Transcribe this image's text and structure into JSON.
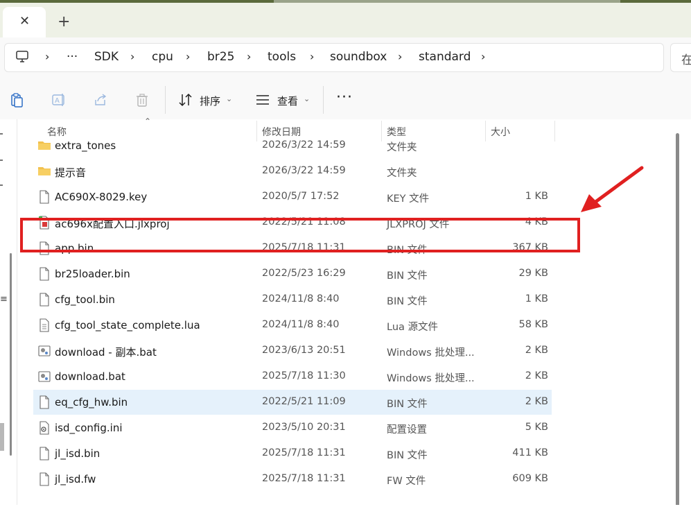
{
  "tabs": {
    "close_glyph": "✕",
    "new_glyph": "+"
  },
  "address": {
    "ellipsis": "···",
    "crumbs": [
      "SDK",
      "cpu",
      "br25",
      "tools",
      "soundbox",
      "standard"
    ],
    "search_text": "在"
  },
  "toolbar": {
    "sort_label": "排序",
    "view_label": "查看",
    "more_glyph": "···"
  },
  "columns": {
    "name": "名称",
    "date": "修改日期",
    "type": "类型",
    "size": "大小"
  },
  "files": [
    {
      "name": "extra_tones",
      "date": "2026/3/22 14:59",
      "type": "文件夹",
      "size": "",
      "icon": "folder-icon"
    },
    {
      "name": "提示音",
      "date": "2026/3/22 14:59",
      "type": "文件夹",
      "size": "",
      "icon": "folder-icon"
    },
    {
      "name": "AC690X-8029.key",
      "date": "2020/5/7 17:52",
      "type": "KEY 文件",
      "size": "1 KB",
      "icon": "file-icon"
    },
    {
      "name": "ac696x配置入口.jlxproj",
      "date": "2022/5/21 11:08",
      "type": "JLXPROJ 文件",
      "size": "4 KB",
      "icon": "jlxproj-file-icon"
    },
    {
      "name": "app.bin",
      "date": "2025/7/18 11:31",
      "type": "BIN 文件",
      "size": "367 KB",
      "icon": "file-icon"
    },
    {
      "name": "br25loader.bin",
      "date": "2022/5/23 16:29",
      "type": "BIN 文件",
      "size": "29 KB",
      "icon": "file-icon"
    },
    {
      "name": "cfg_tool.bin",
      "date": "2024/11/8 8:40",
      "type": "BIN 文件",
      "size": "1 KB",
      "icon": "file-icon"
    },
    {
      "name": "cfg_tool_state_complete.lua",
      "date": "2024/11/8 8:40",
      "type": "Lua 源文件",
      "size": "58 KB",
      "icon": "text-file-icon"
    },
    {
      "name": "download - 副本.bat",
      "date": "2023/6/13 20:51",
      "type": "Windows 批处理...",
      "size": "2 KB",
      "icon": "batch-file-icon"
    },
    {
      "name": "download.bat",
      "date": "2025/7/18 11:30",
      "type": "Windows 批处理...",
      "size": "2 KB",
      "icon": "batch-file-icon"
    },
    {
      "name": "eq_cfg_hw.bin",
      "date": "2022/5/21 11:09",
      "type": "BIN 文件",
      "size": "2 KB",
      "icon": "file-icon"
    },
    {
      "name": "isd_config.ini",
      "date": "2023/5/10 20:31",
      "type": "配置设置",
      "size": "5 KB",
      "icon": "settings-file-icon"
    },
    {
      "name": "jl_isd.bin",
      "date": "2025/7/18 11:31",
      "type": "BIN 文件",
      "size": "411 KB",
      "icon": "file-icon"
    },
    {
      "name": "jl_isd.fw",
      "date": "2025/7/18 11:31",
      "type": "FW 文件",
      "size": "609 KB",
      "icon": "file-icon"
    }
  ],
  "colors": {
    "highlight": "#e02020",
    "selected_row": "#e5f1fb",
    "folder": "#f2c14e"
  }
}
